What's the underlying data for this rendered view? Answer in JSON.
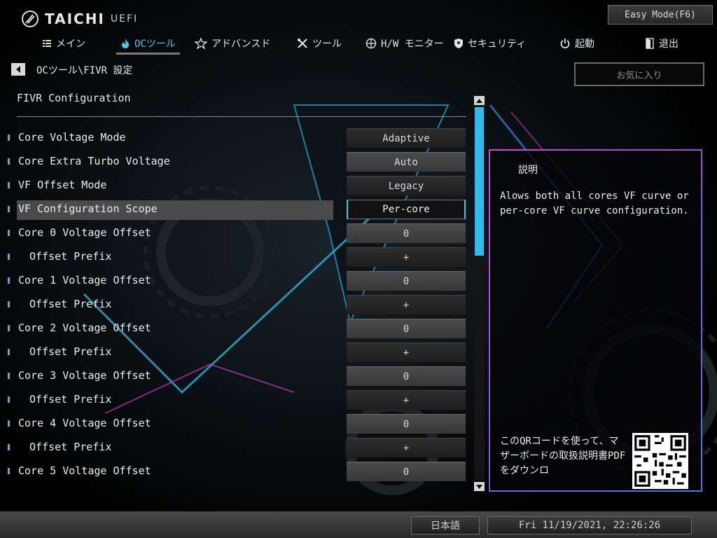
{
  "brand": {
    "name": "TAICHI",
    "sub": "UEFI",
    "logo_icon": "taichi-logo-icon"
  },
  "header": {
    "easy_mode_label": "Easy Mode(F6)"
  },
  "nav": {
    "items": [
      {
        "label": "メイン",
        "icon": "list-icon",
        "active": false
      },
      {
        "label": "OCツール",
        "icon": "flame-icon",
        "active": true
      },
      {
        "label": "アドバンスド",
        "icon": "star-icon",
        "active": false
      },
      {
        "label": "ツール",
        "icon": "tools-icon",
        "active": false
      },
      {
        "label": "H/W モニター",
        "icon": "crosshair-icon",
        "active": false
      },
      {
        "label": "セキュリティ",
        "icon": "shield-icon",
        "active": false
      },
      {
        "label": "起動",
        "icon": "power-icon",
        "active": false
      },
      {
        "label": "退出",
        "icon": "exit-icon",
        "active": false
      }
    ]
  },
  "breadcrumb": "OCツール\\FIVR 設定",
  "favorites_label": "お気に入り",
  "section_title": "FIVR Configuration",
  "settings": [
    {
      "label": "Core Voltage Mode",
      "value": "Adaptive",
      "sub": false,
      "style": "dark"
    },
    {
      "label": "Core Extra Turbo Voltage",
      "value": "Auto",
      "sub": false,
      "style": "light"
    },
    {
      "label": "VF Offset Mode",
      "value": "Legacy",
      "sub": false,
      "style": "dark"
    },
    {
      "label": "VF Configuration Scope",
      "value": "Per-core",
      "sub": false,
      "style": "selected"
    },
    {
      "label": "Core 0 Voltage Offset",
      "value": "0",
      "sub": false,
      "style": "light"
    },
    {
      "label": "Offset Prefix",
      "value": "+",
      "sub": true,
      "style": "dark"
    },
    {
      "label": "Core 1 Voltage Offset",
      "value": "0",
      "sub": false,
      "style": "light"
    },
    {
      "label": "Offset Prefix",
      "value": "+",
      "sub": true,
      "style": "dark"
    },
    {
      "label": "Core 2 Voltage Offset",
      "value": "0",
      "sub": false,
      "style": "light"
    },
    {
      "label": "Offset Prefix",
      "value": "+",
      "sub": true,
      "style": "dark"
    },
    {
      "label": "Core 3 Voltage Offset",
      "value": "0",
      "sub": false,
      "style": "light"
    },
    {
      "label": "Offset Prefix",
      "value": "+",
      "sub": true,
      "style": "dark"
    },
    {
      "label": "Core 4 Voltage Offset",
      "value": "0",
      "sub": false,
      "style": "light"
    },
    {
      "label": "Offset Prefix",
      "value": "+",
      "sub": true,
      "style": "dark"
    },
    {
      "label": "Core 5 Voltage Offset",
      "value": "0",
      "sub": false,
      "style": "light"
    }
  ],
  "description": {
    "title": "説明",
    "text": "Alows both all cores VF curve or per-core VF curve configuration.",
    "qr_text": "このQRコードを使って、マザーボードの取扱説明書PDFをダウンロ"
  },
  "footer": {
    "language": "日本語",
    "datetime": "Fri 11/19/2021, 22:26:26"
  },
  "colors": {
    "accent": "#36b9e6",
    "panel_border_start": "#d445d7",
    "panel_border_end": "#3a7fe2"
  }
}
